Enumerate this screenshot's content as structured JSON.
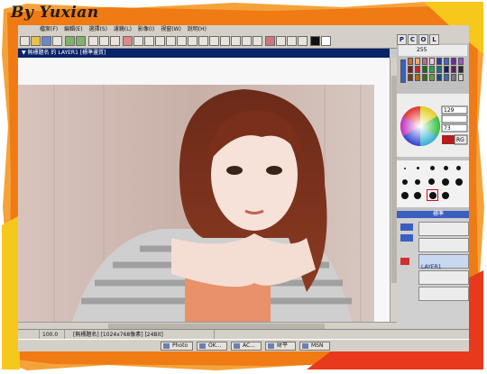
{
  "signature": "By Yuxian",
  "colors": {
    "frame_orange": "#f07a14",
    "frame_red": "#e8391c",
    "frame_yellow": "#f7c81c",
    "titlebar": "#0a246a",
    "workspace": "#c8c8c8"
  },
  "window": {
    "title": "▼ 無標題名 的 LAYER1 [標準畫質]"
  },
  "menu": [
    "檔案(F)",
    "編輯(E)",
    "選擇(S)",
    "濾鏡(L)",
    "影像(I)",
    "視窗(W)",
    "說明(H)"
  ],
  "palette_tabs": [
    "P",
    "C",
    "O",
    "L"
  ],
  "color_panel": {
    "value_a": "255",
    "value_b": "129",
    "value_c": "73",
    "mode_label": "RG"
  },
  "layers_panel": {
    "layer_label": "LAYER1",
    "mode_label": "標準"
  },
  "status": {
    "zoom": "100.0",
    "info": "[無標題名] [1024x768像素] [24Bit]"
  },
  "taskbar": [
    "Photo",
    "OK...",
    "AC...",
    "財平",
    "MSN"
  ]
}
